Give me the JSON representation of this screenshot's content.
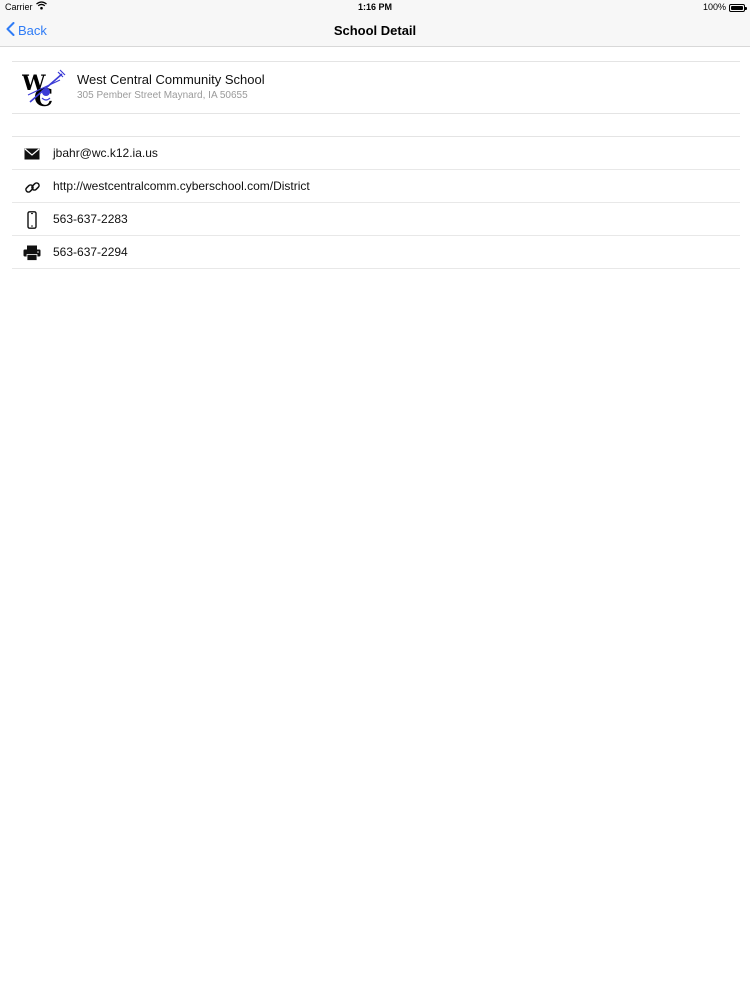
{
  "status_bar": {
    "carrier": "Carrier",
    "time": "1:16 PM",
    "battery": "100%",
    "battery_level": 1.0
  },
  "nav": {
    "back_label": "Back",
    "title": "School Detail"
  },
  "school": {
    "name": "West Central Community School",
    "address": "305 Pember Street Maynard, IA 50655",
    "logo_text": "WC"
  },
  "contacts": [
    {
      "icon": "envelope-icon",
      "value": "jbahr@wc.k12.ia.us"
    },
    {
      "icon": "link-icon",
      "value": "http://westcentralcomm.cyberschool.com/District"
    },
    {
      "icon": "phone-icon",
      "value": "563-637-2283"
    },
    {
      "icon": "fax-icon",
      "value": "563-637-2294"
    }
  ],
  "colors": {
    "accent": "#2f7cf6",
    "logo_blue": "#3b3bd6"
  }
}
